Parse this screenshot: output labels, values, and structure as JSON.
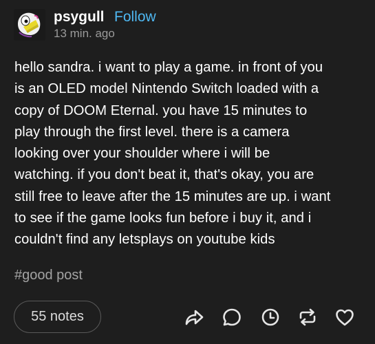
{
  "post": {
    "username": "psygull",
    "follow_label": "Follow",
    "timestamp": "13 min. ago",
    "body_lines": [
      "hello sandra. i want to play a game. in front of you",
      "is an OLED model Nintendo Switch loaded with a",
      "copy of DOOM Eternal. you have 15 minutes to",
      "play through the first level. there is a camera",
      "looking over your shoulder where i will be",
      "watching. if you don't beat it, that's okay, you are",
      "still free to leave after the 15 minutes are up. i want",
      "to see if the game looks fun before i buy it, and i",
      "couldn't find any letsplays on youtube kids"
    ],
    "tag": "#good post",
    "notes_label": "55 notes"
  },
  "actions": [
    {
      "icon": "share-icon"
    },
    {
      "icon": "reply-icon"
    },
    {
      "icon": "clock-icon"
    },
    {
      "icon": "reblog-icon"
    },
    {
      "icon": "heart-icon"
    }
  ],
  "colors": {
    "background": "#1e1e1e",
    "text": "#ffffff",
    "follow": "#4fb8f2",
    "muted": "#9a9a9a",
    "icon": "#e6e6e6"
  }
}
